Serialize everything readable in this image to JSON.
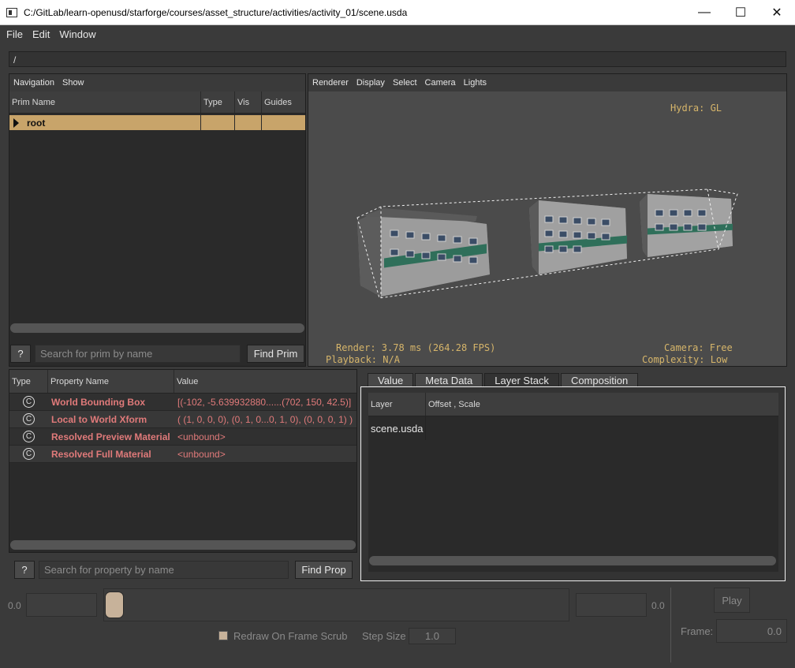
{
  "window": {
    "title": "C:/GitLab/learn-openusd/starforge/courses/asset_structure/activities/activity_01/scene.usda",
    "minimize": "—",
    "maximize": "☐",
    "close": "✕"
  },
  "menu": [
    "File",
    "Edit",
    "Window"
  ],
  "path": "/",
  "navigation": {
    "toolbar": [
      "Navigation",
      "Show"
    ],
    "columns": [
      "Prim Name",
      "Type",
      "Vis",
      "Guides"
    ],
    "rows": [
      {
        "name": "root",
        "type": "",
        "vis": "",
        "guides": ""
      }
    ],
    "help_label": "?",
    "search_placeholder": "Search for prim by name",
    "find_label": "Find Prim"
  },
  "viewport": {
    "toolbar": [
      "Renderer",
      "Display",
      "Select",
      "Camera",
      "Lights"
    ],
    "hud_hydra": "Hydra: GL",
    "hud_render": "Render: 3.78 ms (264.28 FPS)",
    "hud_playback": "Playback: N/A",
    "hud_camera": "Camera: Free",
    "hud_complexity": "Complexity: Low"
  },
  "properties": {
    "columns": [
      "Type",
      "Property Name",
      "Value"
    ],
    "type_glyph": "C",
    "rows": [
      {
        "name": "World Bounding Box",
        "value": "[(-102, -5.639932880......(702, 150, 42.5)]"
      },
      {
        "name": "Local to World Xform",
        "value": "( (1, 0, 0, 0), (0, 1, 0...0, 1, 0), (0, 0, 0, 1) )"
      },
      {
        "name": "Resolved Preview Material",
        "value": "<unbound>"
      },
      {
        "name": "Resolved Full Material",
        "value": "<unbound>"
      }
    ],
    "help_label": "?",
    "search_placeholder": "Search for property by name",
    "find_label": "Find Prop"
  },
  "inspector": {
    "tabs": [
      "Value",
      "Meta Data",
      "Layer Stack",
      "Composition"
    ],
    "active_tab": 2,
    "columns": [
      "Layer",
      "Offset , Scale"
    ],
    "rows": [
      {
        "layer": "scene.usda",
        "offset": ""
      }
    ]
  },
  "timeline": {
    "start": "0.0",
    "end": "0.0",
    "play_label": "Play",
    "redraw_label": "Redraw On Frame Scrub",
    "step_label": "Step Size",
    "step_value": "1.0",
    "frame_label": "Frame:",
    "frame_value": "0.0"
  }
}
